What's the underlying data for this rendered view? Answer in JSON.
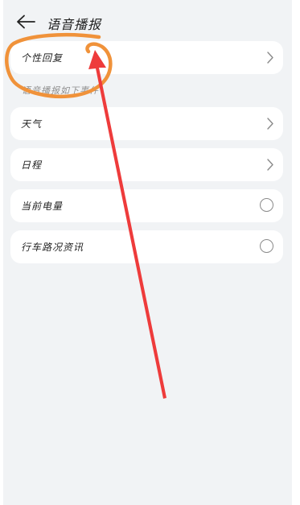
{
  "header": {
    "title": "语音播报",
    "back_icon": "arrow-left-icon"
  },
  "items": [
    {
      "label": "个性回复",
      "control": "chevron"
    }
  ],
  "section": {
    "label": "语音播报如下事件"
  },
  "events": [
    {
      "label": "天气",
      "control": "chevron"
    },
    {
      "label": "日程",
      "control": "chevron"
    },
    {
      "label": "当前电量",
      "control": "radio",
      "checked": false
    },
    {
      "label": "行车路况资讯",
      "control": "radio",
      "checked": false
    }
  ],
  "annotation": {
    "circle_color": "#f0923a",
    "arrow_color": "#ee3b3b"
  },
  "colors": {
    "background": "#f1f3f5",
    "card": "#ffffff",
    "text": "#222222"
  }
}
